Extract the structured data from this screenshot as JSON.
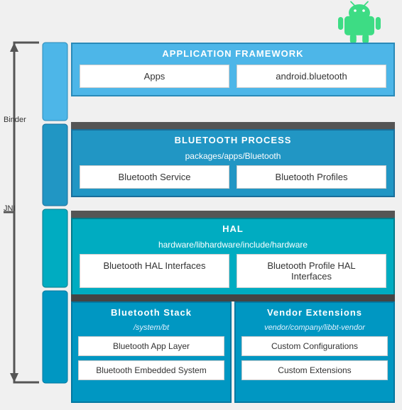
{
  "android_logo": {
    "alt": "Android Logo"
  },
  "sections": {
    "app_framework": {
      "title": "APPLICATION FRAMEWORK",
      "cards": [
        {
          "label": "Apps"
        },
        {
          "label": "android.bluetooth"
        }
      ]
    },
    "binder_label": "Binder",
    "bt_process": {
      "title": "BLUETOOTH PROCESS",
      "subtitle": "packages/apps/Bluetooth",
      "cards": [
        {
          "label": "Bluetooth Service"
        },
        {
          "label": "Bluetooth Profiles"
        }
      ]
    },
    "jni_label": "JNI",
    "hal": {
      "title": "HAL",
      "subtitle": "hardware/libhardware/include/hardware",
      "cards": [
        {
          "label": "Bluetooth HAL Interfaces"
        },
        {
          "label": "Bluetooth Profile HAL Interfaces"
        }
      ]
    },
    "bt_stack": {
      "title": "Bluetooth Stack",
      "path": "/system/bt",
      "cards": [
        {
          "label": "Bluetooth App Layer"
        },
        {
          "label": "Bluetooth Embedded System"
        }
      ]
    },
    "vendor": {
      "title": "Vendor Extensions",
      "path": "vendor/company/libbt-vendor",
      "cards": [
        {
          "label": "Custom Configurations"
        },
        {
          "label": "Custom Extensions"
        }
      ]
    }
  }
}
